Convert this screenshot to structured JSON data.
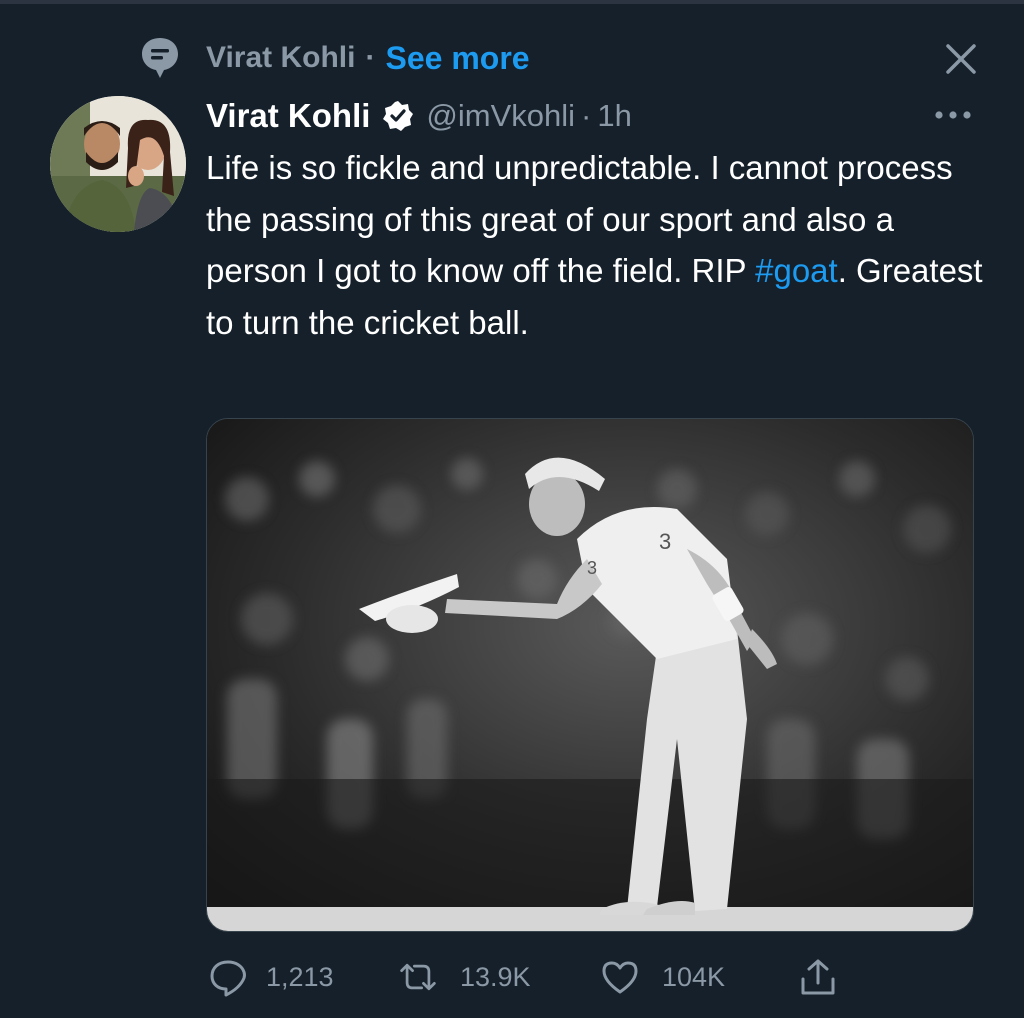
{
  "context": {
    "icon": "speech-bubble-icon",
    "name": "Virat Kohli",
    "separator": "·",
    "see_more": "See more"
  },
  "close": {
    "icon": "close-icon"
  },
  "tweet": {
    "display_name": "Virat Kohli",
    "verified": true,
    "handle": "@imVkohli",
    "separator": "·",
    "time": "1h",
    "text_before_hashtag": "Life is so fickle and unpredictable. I cannot process the passing of this great of our sport and also a person I got to know off the field. RIP ",
    "hashtag": "#goat",
    "text_after_hashtag": ". Greatest to turn the cricket ball."
  },
  "media": {
    "description_icon": "photo-image"
  },
  "actions": {
    "reply": {
      "icon": "reply-icon",
      "count": "1,213"
    },
    "retweet": {
      "icon": "retweet-icon",
      "count": "13.9K"
    },
    "like": {
      "icon": "heart-icon",
      "count": "104K"
    },
    "share": {
      "icon": "share-icon"
    }
  },
  "colors": {
    "background": "#15202b",
    "accent": "#1d9bf0",
    "secondary_text": "#8b98a5",
    "primary_text": "#ffffff"
  }
}
